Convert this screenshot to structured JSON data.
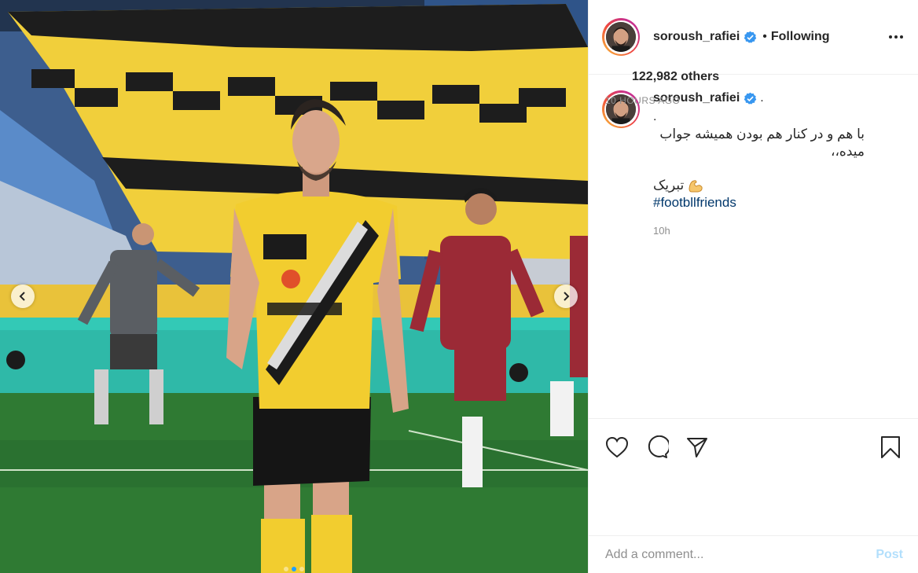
{
  "post": {
    "author": "soroush_rafiei",
    "follow_state": "Following",
    "separator": "•",
    "verified_icon": "verified-badge-icon",
    "more_icon": "more-options-icon"
  },
  "caption": {
    "username": "soroush_rafiei",
    "trailing": ".",
    "line_dot": ".",
    "text": "با هم و در کنار هم بودن همیشه جواب میده،،",
    "congrats": "تبریک",
    "emoji_icon": "flexed-biceps-icon",
    "hashtag": "#footbllfriends",
    "age": "10h"
  },
  "actions": {
    "like_icon": "heart-icon",
    "comment_icon": "comment-icon",
    "share_icon": "share-icon",
    "save_icon": "bookmark-icon"
  },
  "likes": {
    "text": "122,982 others"
  },
  "timestamp": "10 HOURS AGO",
  "comment": {
    "placeholder": "Add a comment...",
    "post_label": "Post"
  },
  "carousel": {
    "prev_icon": "chevron-left-icon",
    "next_icon": "chevron-right-icon",
    "slides": 3,
    "active": 1
  },
  "colors": {
    "link": "#00376b",
    "verified": "#3897f0",
    "post_disabled": "#b2dffc",
    "muted": "#8e8e8e",
    "carousel_active": "#1fa0ff"
  }
}
